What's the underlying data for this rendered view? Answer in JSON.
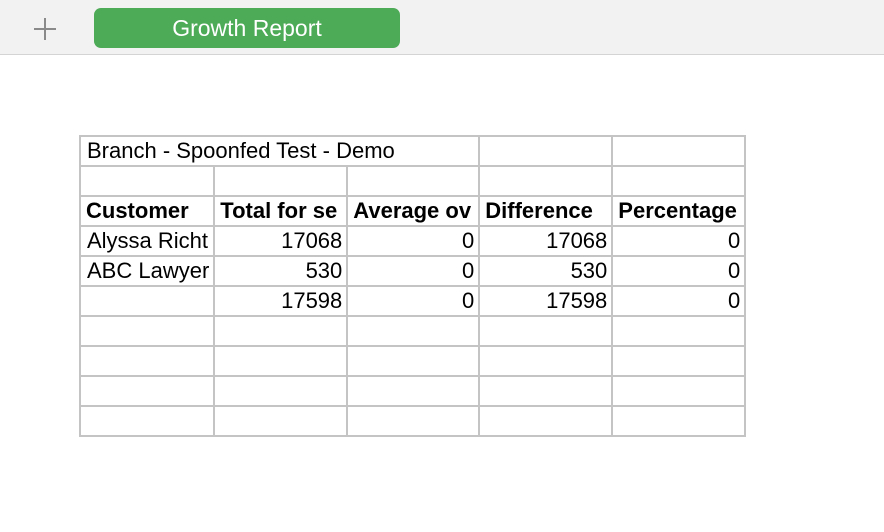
{
  "tabbar": {
    "add_icon": "plus-icon",
    "active_tab_label": "Growth Report",
    "accent_color": "#4daa57"
  },
  "sheet": {
    "title": "Branch - Spoonfed Test - Demo",
    "headers": [
      "Customer",
      "Total for se",
      "Average ov",
      "Difference",
      "Percentage"
    ],
    "rows": [
      [
        "Alyssa Richt",
        "17068",
        "0",
        "17068",
        "0"
      ],
      [
        "ABC Lawyer",
        "530",
        "0",
        "530",
        "0"
      ],
      [
        "",
        "17598",
        "0",
        "17598",
        "0"
      ]
    ]
  }
}
